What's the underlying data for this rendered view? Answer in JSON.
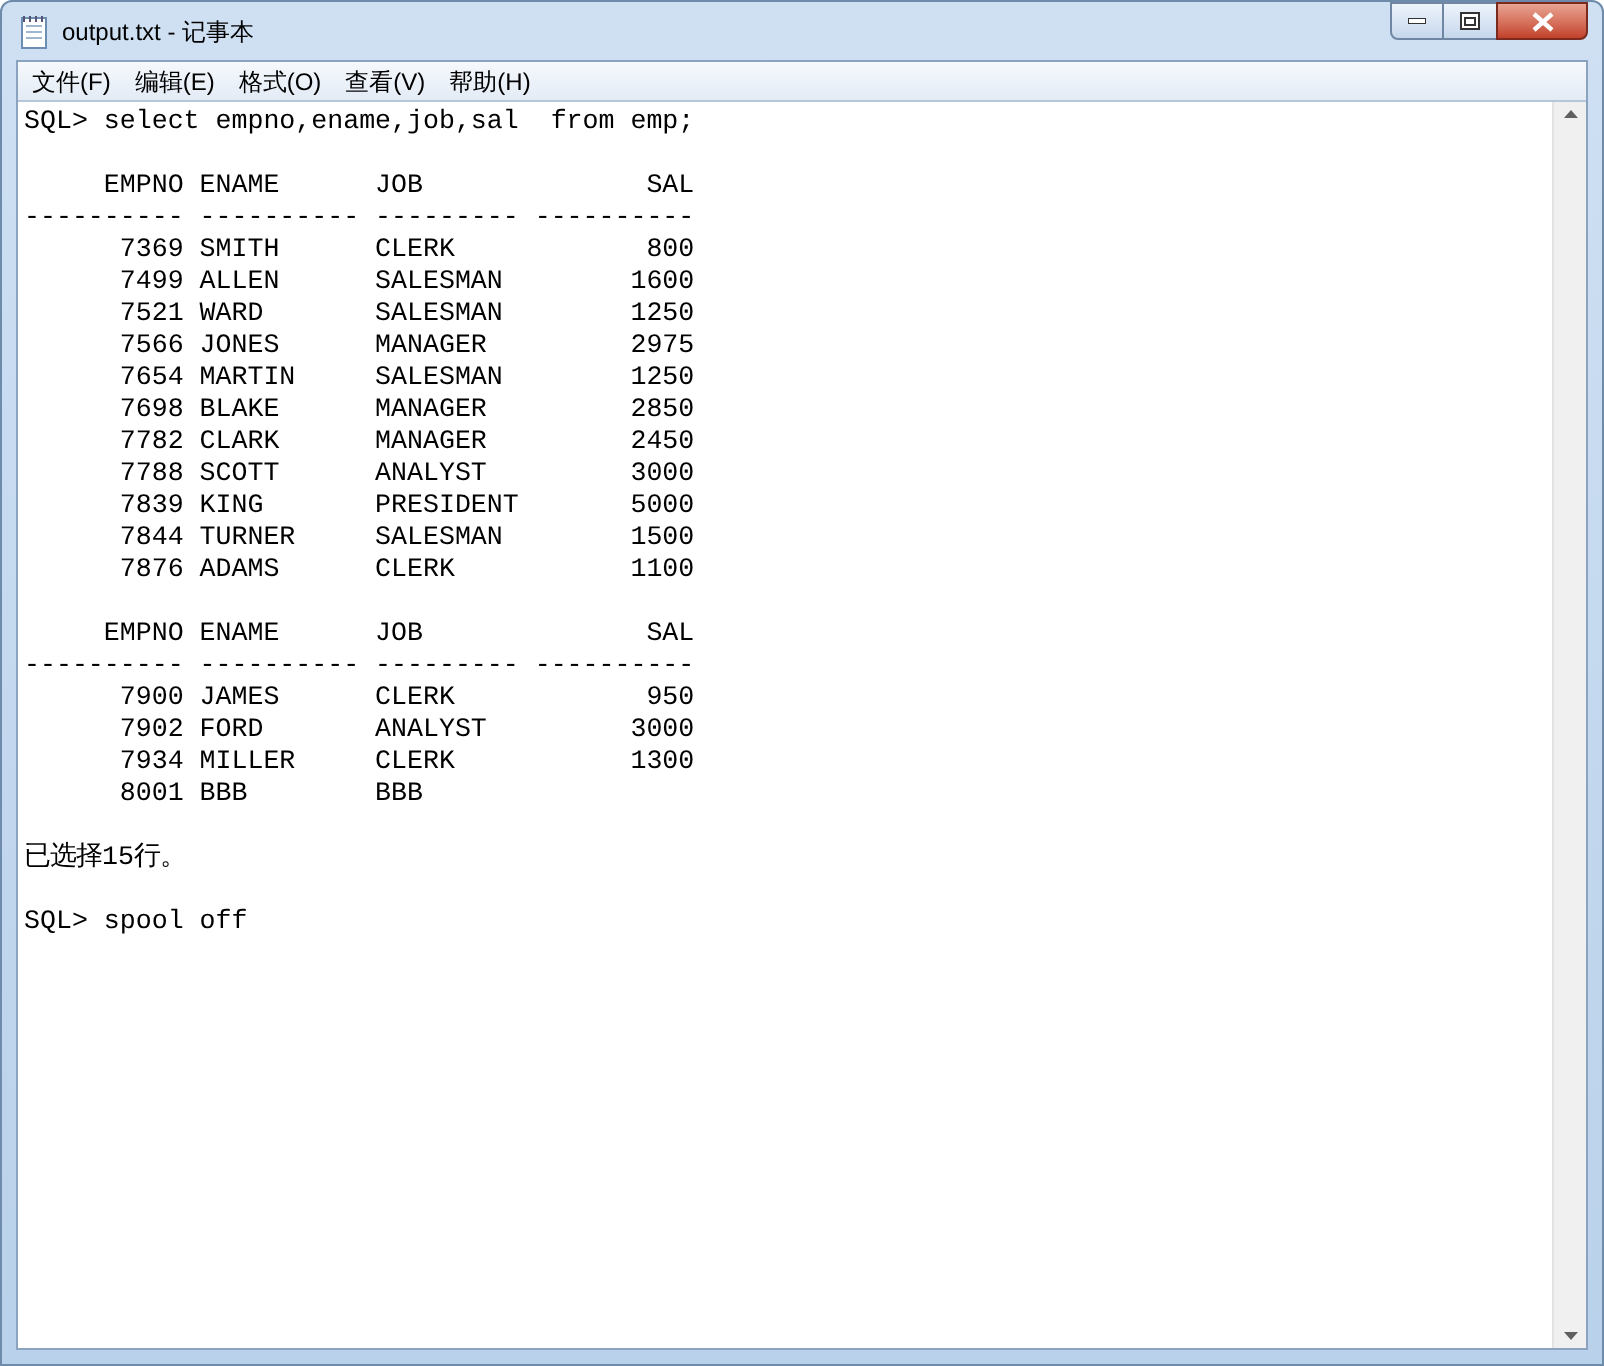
{
  "window": {
    "title": "output.txt - 记事本"
  },
  "menu": [
    "文件(F)",
    "编辑(E)",
    "格式(O)",
    "查看(V)",
    "帮助(H)"
  ],
  "document": {
    "blocks": [
      [
        "SQL> select empno,ename,job,sal  from emp;"
      ],
      [
        "     EMPNO ENAME      JOB              SAL",
        "---------- ---------- --------- ----------",
        "      7369 SMITH      CLERK            800",
        "      7499 ALLEN      SALESMAN        1600",
        "      7521 WARD       SALESMAN        1250",
        "      7566 JONES      MANAGER         2975",
        "      7654 MARTIN     SALESMAN        1250",
        "      7698 BLAKE      MANAGER         2850",
        "      7782 CLARK      MANAGER         2450",
        "      7788 SCOTT      ANALYST         3000",
        "      7839 KING       PRESIDENT       5000",
        "      7844 TURNER     SALESMAN        1500",
        "      7876 ADAMS      CLERK           1100"
      ],
      [
        "     EMPNO ENAME      JOB              SAL",
        "---------- ---------- --------- ----------",
        "      7900 JAMES      CLERK            950",
        "      7902 FORD       ANALYST         3000",
        "      7934 MILLER     CLERK           1300",
        "      8001 BBB        BBB"
      ],
      [
        "已选择15行。"
      ],
      [
        "SQL> spool off"
      ]
    ]
  }
}
